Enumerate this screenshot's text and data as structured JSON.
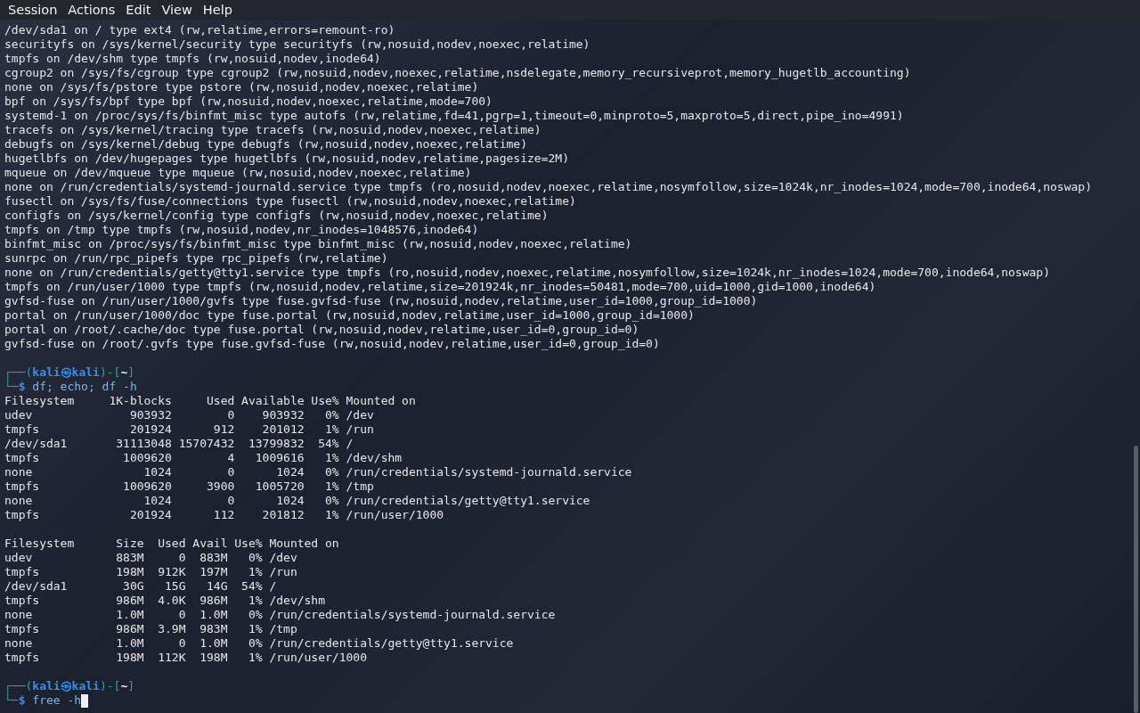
{
  "menu": [
    {
      "label": "Session"
    },
    {
      "label": "Actions"
    },
    {
      "label": "Edit"
    },
    {
      "label": "View"
    },
    {
      "label": "Help"
    }
  ],
  "lines": [
    {
      "kind": "output",
      "text": "/dev/sda1 on / type ext4 (rw,relatime,errors=remount-ro)"
    },
    {
      "kind": "output",
      "text": "securityfs on /sys/kernel/security type securityfs (rw,nosuid,nodev,noexec,relatime)"
    },
    {
      "kind": "output",
      "text": "tmpfs on /dev/shm type tmpfs (rw,nosuid,nodev,inode64)"
    },
    {
      "kind": "output",
      "text": "cgroup2 on /sys/fs/cgroup type cgroup2 (rw,nosuid,nodev,noexec,relatime,nsdelegate,memory_recursiveprot,memory_hugetlb_accounting)"
    },
    {
      "kind": "output",
      "text": "none on /sys/fs/pstore type pstore (rw,nosuid,nodev,noexec,relatime)"
    },
    {
      "kind": "output",
      "text": "bpf on /sys/fs/bpf type bpf (rw,nosuid,nodev,noexec,relatime,mode=700)"
    },
    {
      "kind": "output",
      "text": "systemd-1 on /proc/sys/fs/binfmt_misc type autofs (rw,relatime,fd=41,pgrp=1,timeout=0,minproto=5,maxproto=5,direct,pipe_ino=4991)"
    },
    {
      "kind": "output",
      "text": "tracefs on /sys/kernel/tracing type tracefs (rw,nosuid,nodev,noexec,relatime)"
    },
    {
      "kind": "output",
      "text": "debugfs on /sys/kernel/debug type debugfs (rw,nosuid,nodev,noexec,relatime)"
    },
    {
      "kind": "output",
      "text": "hugetlbfs on /dev/hugepages type hugetlbfs (rw,nosuid,nodev,relatime,pagesize=2M)"
    },
    {
      "kind": "output",
      "text": "mqueue on /dev/mqueue type mqueue (rw,nosuid,nodev,noexec,relatime)"
    },
    {
      "kind": "output",
      "text": "none on /run/credentials/systemd-journald.service type tmpfs (ro,nosuid,nodev,noexec,relatime,nosymfollow,size=1024k,nr_inodes=1024,mode=700,inode64,noswap)"
    },
    {
      "kind": "output",
      "text": "fusectl on /sys/fs/fuse/connections type fusectl (rw,nosuid,nodev,noexec,relatime)"
    },
    {
      "kind": "output",
      "text": "configfs on /sys/kernel/config type configfs (rw,nosuid,nodev,noexec,relatime)"
    },
    {
      "kind": "output",
      "text": "tmpfs on /tmp type tmpfs (rw,nosuid,nodev,nr_inodes=1048576,inode64)"
    },
    {
      "kind": "output",
      "text": "binfmt_misc on /proc/sys/fs/binfmt_misc type binfmt_misc (rw,nosuid,nodev,noexec,relatime)"
    },
    {
      "kind": "output",
      "text": "sunrpc on /run/rpc_pipefs type rpc_pipefs (rw,relatime)"
    },
    {
      "kind": "output",
      "text": "none on /run/credentials/getty@tty1.service type tmpfs (ro,nosuid,nodev,noexec,relatime,nosymfollow,size=1024k,nr_inodes=1024,mode=700,inode64,noswap)"
    },
    {
      "kind": "output",
      "text": "tmpfs on /run/user/1000 type tmpfs (rw,nosuid,nodev,relatime,size=201924k,nr_inodes=50481,mode=700,uid=1000,gid=1000,inode64)"
    },
    {
      "kind": "output",
      "text": "gvfsd-fuse on /run/user/1000/gvfs type fuse.gvfsd-fuse (rw,nosuid,nodev,relatime,user_id=1000,group_id=1000)"
    },
    {
      "kind": "output",
      "text": "portal on /run/user/1000/doc type fuse.portal (rw,nosuid,nodev,relatime,user_id=1000,group_id=1000)"
    },
    {
      "kind": "output",
      "text": "portal on /root/.cache/doc type fuse.portal (rw,nosuid,nodev,relatime,user_id=0,group_id=0)"
    },
    {
      "kind": "output",
      "text": "gvfsd-fuse on /root/.gvfs type fuse.gvfsd-fuse (rw,nosuid,nodev,relatime,user_id=0,group_id=0)"
    },
    {
      "kind": "blank"
    },
    {
      "kind": "prompt",
      "segments": [
        {
          "kind": "frame",
          "text": "┌──("
        },
        {
          "kind": "user",
          "text": "kali㉿kali"
        },
        {
          "kind": "frame",
          "text": ")-["
        },
        {
          "kind": "dir",
          "text": "~"
        },
        {
          "kind": "frame",
          "text": "]"
        }
      ]
    },
    {
      "kind": "command",
      "cursor": false,
      "segments": [
        {
          "kind": "frame",
          "text": "└─"
        },
        {
          "kind": "user",
          "text": "$"
        },
        {
          "kind": "cmd",
          "text": " df; echo; df -h"
        }
      ]
    },
    {
      "kind": "output",
      "text": "Filesystem     1K-blocks     Used Available Use% Mounted on"
    },
    {
      "kind": "output",
      "text": "udev              903932        0    903932   0% /dev"
    },
    {
      "kind": "output",
      "text": "tmpfs             201924      912    201012   1% /run"
    },
    {
      "kind": "output",
      "text": "/dev/sda1       31113048 15707432  13799832  54% /"
    },
    {
      "kind": "output",
      "text": "tmpfs            1009620        4   1009616   1% /dev/shm"
    },
    {
      "kind": "output",
      "text": "none                1024        0      1024   0% /run/credentials/systemd-journald.service"
    },
    {
      "kind": "output",
      "text": "tmpfs            1009620     3900   1005720   1% /tmp"
    },
    {
      "kind": "output",
      "text": "none                1024        0      1024   0% /run/credentials/getty@tty1.service"
    },
    {
      "kind": "output",
      "text": "tmpfs             201924      112    201812   1% /run/user/1000"
    },
    {
      "kind": "blank"
    },
    {
      "kind": "output",
      "text": "Filesystem      Size  Used Avail Use% Mounted on"
    },
    {
      "kind": "output",
      "text": "udev            883M     0  883M   0% /dev"
    },
    {
      "kind": "output",
      "text": "tmpfs           198M  912K  197M   1% /run"
    },
    {
      "kind": "output",
      "text": "/dev/sda1        30G   15G   14G  54% /"
    },
    {
      "kind": "output",
      "text": "tmpfs           986M  4.0K  986M   1% /dev/shm"
    },
    {
      "kind": "output",
      "text": "none            1.0M     0  1.0M   0% /run/credentials/systemd-journald.service"
    },
    {
      "kind": "output",
      "text": "tmpfs           986M  3.9M  983M   1% /tmp"
    },
    {
      "kind": "output",
      "text": "none            1.0M     0  1.0M   0% /run/credentials/getty@tty1.service"
    },
    {
      "kind": "output",
      "text": "tmpfs           198M  112K  198M   1% /run/user/1000"
    },
    {
      "kind": "blank"
    },
    {
      "kind": "prompt",
      "segments": [
        {
          "kind": "frame",
          "text": "┌──("
        },
        {
          "kind": "user",
          "text": "kali㉿kali"
        },
        {
          "kind": "frame",
          "text": ")-["
        },
        {
          "kind": "dir",
          "text": "~"
        },
        {
          "kind": "frame",
          "text": "]"
        }
      ]
    },
    {
      "kind": "command",
      "cursor": true,
      "segments": [
        {
          "kind": "frame",
          "text": "└─"
        },
        {
          "kind": "user",
          "text": "$"
        },
        {
          "kind": "cmd",
          "text": " free -h"
        }
      ]
    }
  ]
}
